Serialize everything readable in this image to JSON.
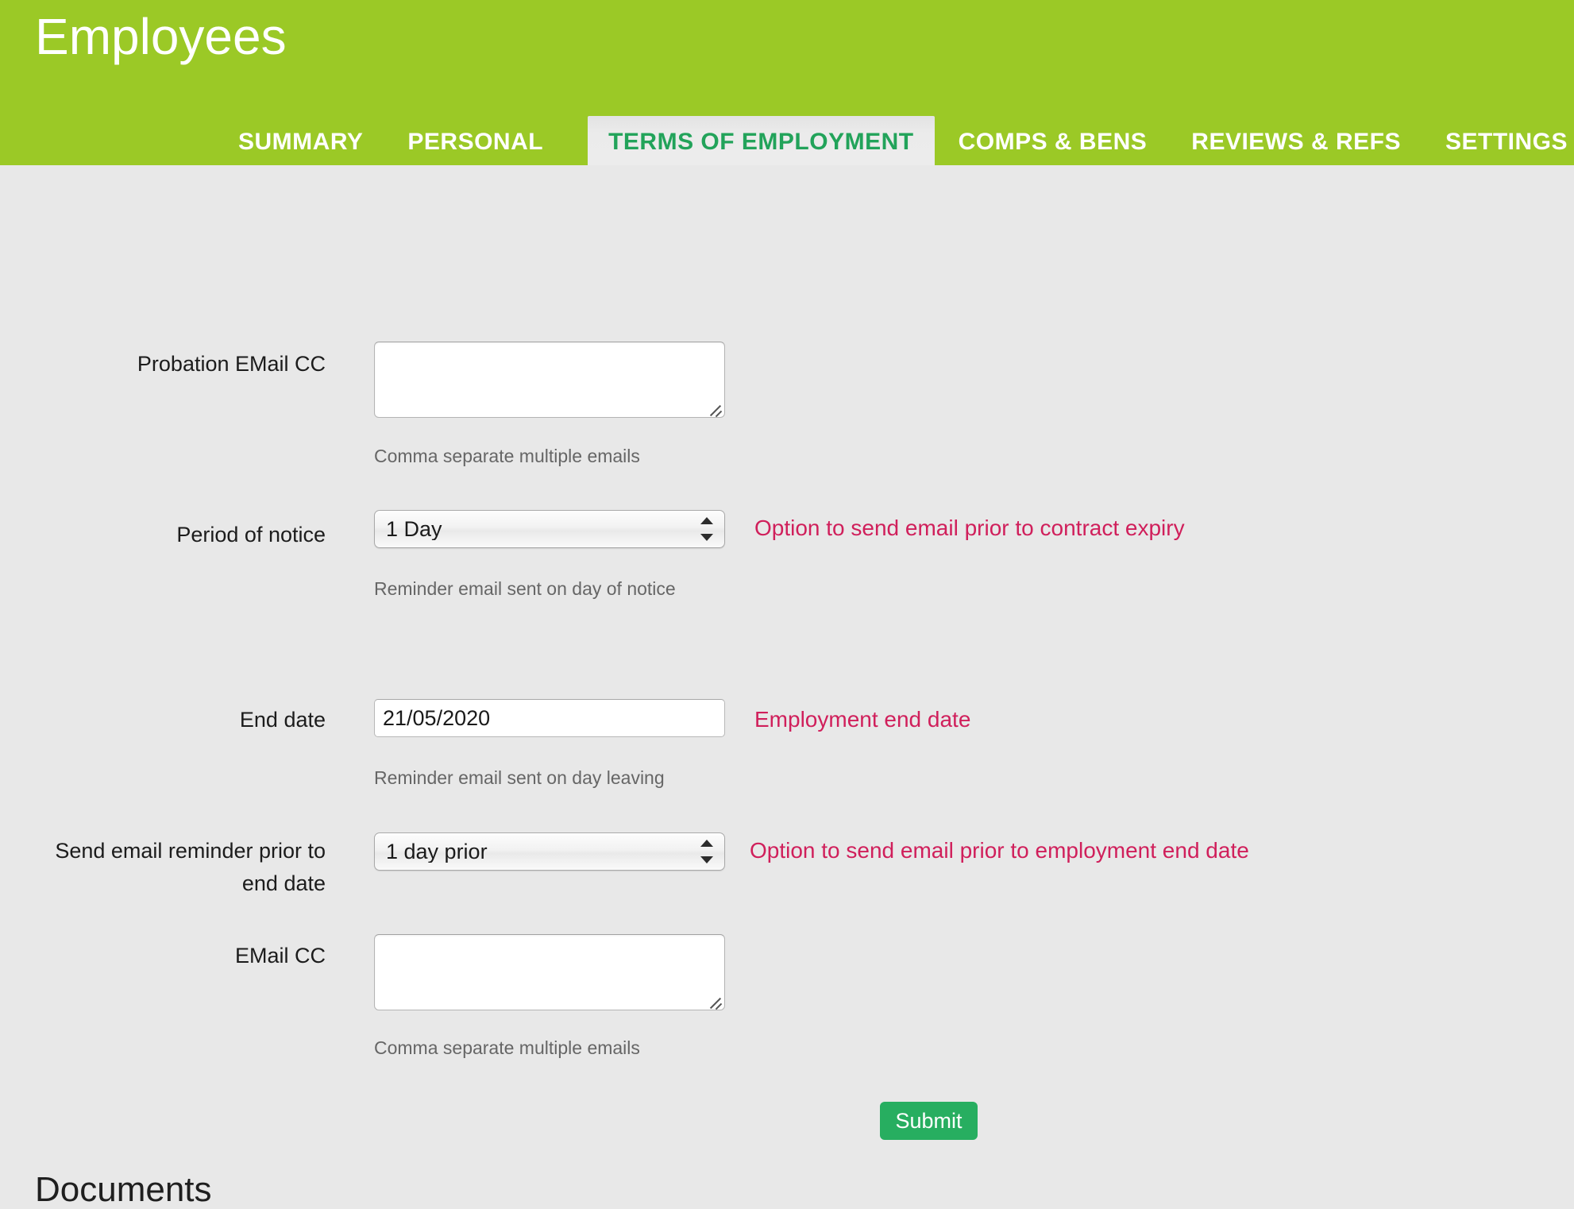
{
  "header": {
    "title": "Employees",
    "bg_color": "#9bc926",
    "title_color": "#ffffff"
  },
  "tabs": [
    {
      "label": "SUMMARY",
      "active": false
    },
    {
      "label": "PERSONAL",
      "active": false
    },
    {
      "label": "TERMS OF EMPLOYMENT",
      "active": true
    },
    {
      "label": "COMPS & BENS",
      "active": false
    },
    {
      "label": "REVIEWS & REFS",
      "active": false
    },
    {
      "label": "SETTINGS",
      "active": false
    }
  ],
  "colors": {
    "accent_green": "#9bc926",
    "active_tab_text": "#22a35a",
    "annotation": "#d01f5b",
    "submit_green": "#27ae60",
    "page_background": "#e8e8e8"
  },
  "form": {
    "fields": [
      {
        "id": "probation-email-cc",
        "label": "Probation EMail CC",
        "type": "textarea",
        "value": "",
        "hint": "Comma separate multiple emails",
        "annotation": ""
      },
      {
        "id": "period-of-notice",
        "label": "Period of notice",
        "type": "select",
        "value": "1 Day",
        "hint": "Reminder email sent on day of notice",
        "annotation": "Option to send email prior to contract expiry"
      },
      {
        "id": "end-date",
        "label": "End date",
        "type": "text",
        "value": "21/05/2020",
        "hint": "Reminder email sent on day leaving",
        "annotation": "Employment end date"
      },
      {
        "id": "send-email-reminder-prior-to-end-date",
        "label": "Send email reminder prior to\nend date",
        "type": "select",
        "value": "1 day prior",
        "hint": "",
        "annotation": "Option to send email prior to employment end date"
      },
      {
        "id": "email-cc",
        "label": "EMail CC",
        "type": "textarea",
        "value": "",
        "hint": "Comma separate multiple emails",
        "annotation": ""
      }
    ],
    "submit_label": "Submit"
  },
  "sections": {
    "documents_heading": "Documents"
  }
}
